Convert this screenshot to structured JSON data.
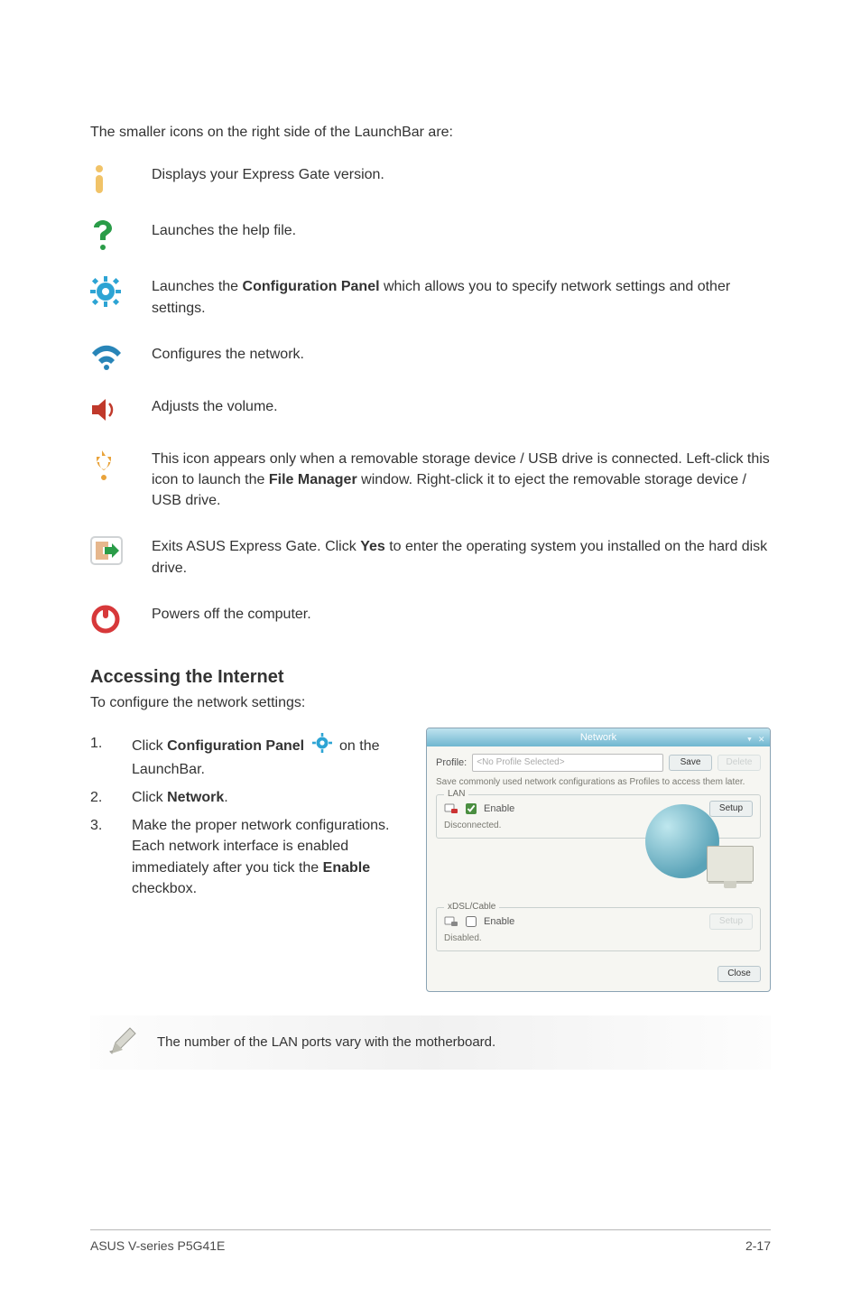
{
  "intro": "The smaller icons on the right side of the LaunchBar are:",
  "icons": [
    {
      "desc": "Displays your Express Gate version."
    },
    {
      "desc": "Launches the help file."
    },
    {
      "desc_parts": [
        "Launches the ",
        "Configuration Panel",
        " which allows you to specify network settings and other settings."
      ]
    },
    {
      "desc": "Configures the network."
    },
    {
      "desc": "Adjusts the volume."
    },
    {
      "desc_parts": [
        "This icon appears only when a removable storage device / USB drive is connected. Left-click this icon to launch the ",
        "File Manager",
        " window. Right-click it to eject the removable storage device / USB drive."
      ]
    },
    {
      "desc_parts": [
        "Exits ASUS Express Gate. Click ",
        "Yes",
        " to enter the operating system you installed on the hard disk drive."
      ]
    },
    {
      "desc": "Powers off the computer."
    }
  ],
  "section_heading": "Accessing the Internet",
  "section_subintro": "To configure the network settings:",
  "steps": {
    "s1": {
      "num": "1.",
      "pre": "Click ",
      "bold": "Configuration Panel",
      "post_icon": " on the LaunchBar."
    },
    "s2": {
      "num": "2.",
      "pre": "Click ",
      "bold": "Network",
      "post": "."
    },
    "s3": {
      "num": "3.",
      "pre": "Make the proper network configurations. Each network interface is enabled immediately after you tick the ",
      "bold": "Enable",
      "post": " checkbox."
    }
  },
  "network_window": {
    "title": "Network",
    "profile_label": "Profile:",
    "profile_placeholder": "<No Profile Selected>",
    "save_label": "Save",
    "delete_label": "Delete",
    "note": "Save commonly used network configurations as Profiles to access them later.",
    "lan": {
      "legend": "LAN",
      "enable_label": "Enable",
      "setup_label": "Setup",
      "status": "Disconnected."
    },
    "xdsl": {
      "legend": "xDSL/Cable",
      "enable_label": "Enable",
      "setup_label": "Setup",
      "status": "Disabled."
    },
    "close_label": "Close"
  },
  "callout_note": "The number of the LAN ports vary with the motherboard.",
  "footer": {
    "left": "ASUS V-series P5G41E",
    "right": "2-17"
  }
}
